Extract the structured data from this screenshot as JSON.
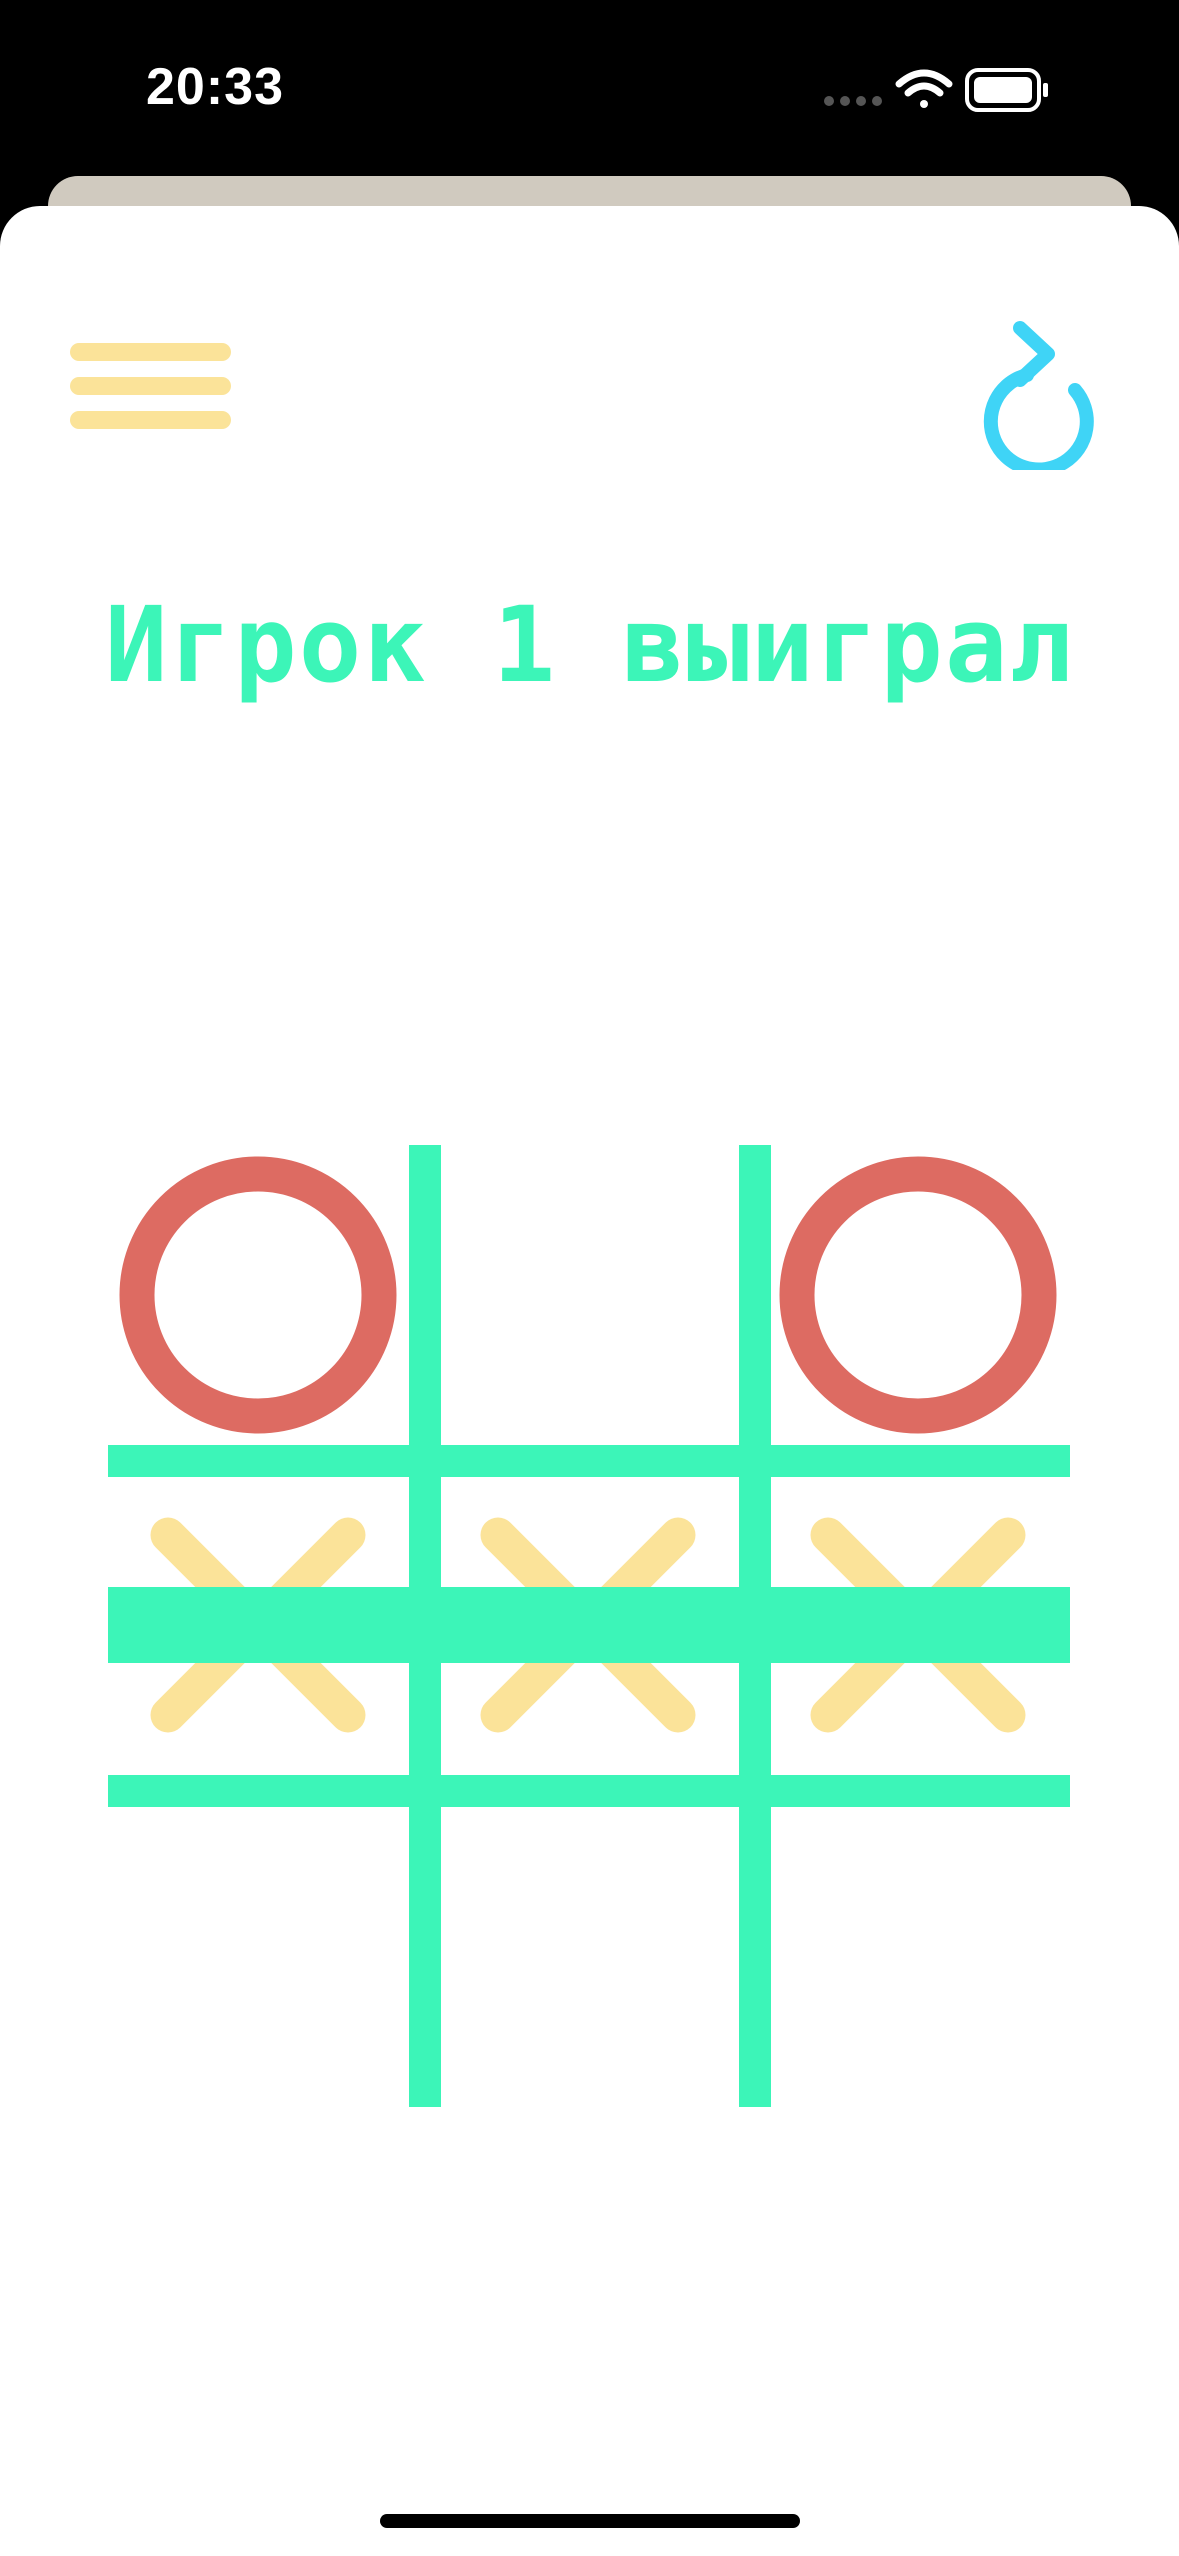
{
  "status_bar": {
    "time": "20:33",
    "icons": [
      "signal-dots-icon",
      "wifi-icon",
      "battery-icon"
    ]
  },
  "toolbar": {
    "menu_icon": "hamburger-menu-icon",
    "restart_icon": "restart-arrow-icon"
  },
  "result": {
    "text": "Игрок 1 выиграл"
  },
  "board": {
    "cells": [
      "O",
      "",
      "O",
      "X",
      "X",
      "X",
      "",
      "",
      ""
    ],
    "winning_row": 1
  },
  "colors": {
    "grid": "#3cf5b8",
    "o_mark": "#dd6b62",
    "x_mark": "#fbe399",
    "menu": "#fbe399",
    "restart": "#3fd4f6",
    "title": "#3cf5b8"
  }
}
